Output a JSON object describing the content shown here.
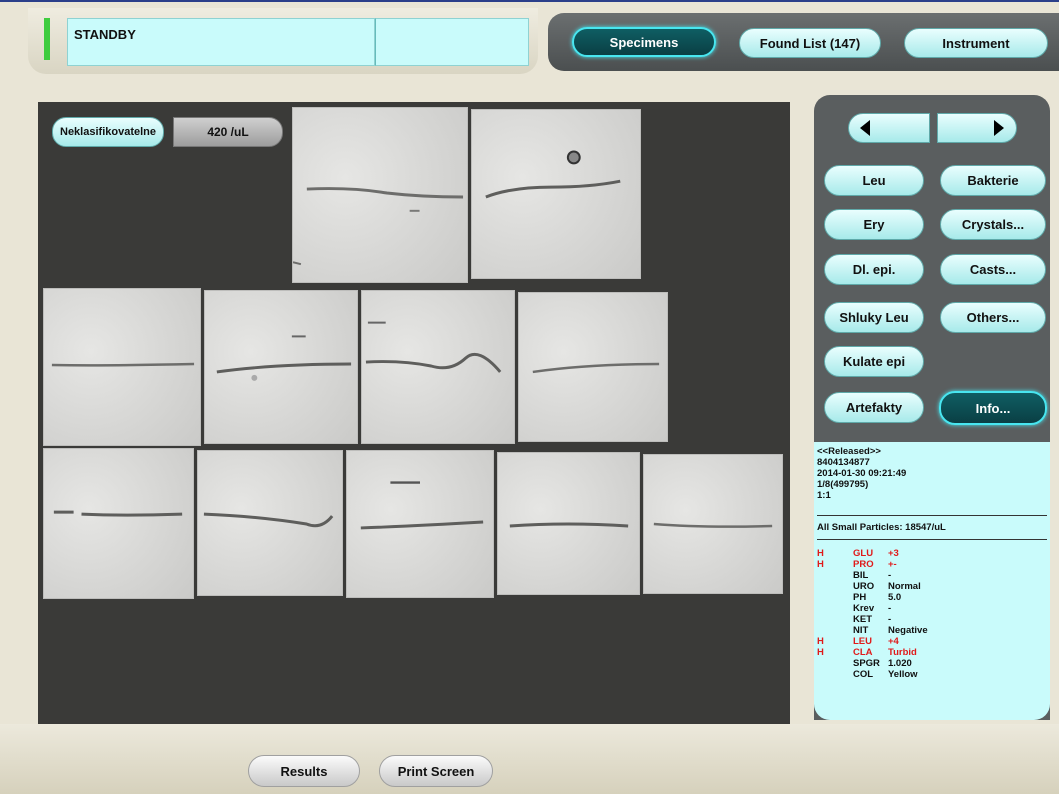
{
  "status": {
    "text": "STANDBY",
    "indicator_color": "#3fcc3f"
  },
  "tabs": [
    {
      "label": "Specimens",
      "active": true
    },
    {
      "label": "Found List (147)",
      "active": false
    },
    {
      "label": "Instrument",
      "active": false
    }
  ],
  "viewer": {
    "class_label": "Neklasifikovatelne",
    "count_label": "420 /uL"
  },
  "categories": [
    {
      "label": "Leu"
    },
    {
      "label": "Bakterie"
    },
    {
      "label": "Ery"
    },
    {
      "label": "Crystals..."
    },
    {
      "label": "Dl. epi."
    },
    {
      "label": "Casts..."
    },
    {
      "label": "Shluky Leu"
    },
    {
      "label": "Others..."
    },
    {
      "label": "Kulate epi"
    },
    {
      "label": "Artefakty"
    },
    {
      "label": "Info...",
      "active": true
    }
  ],
  "info": {
    "released": "<<Released>>",
    "sample_id": "8404134877",
    "datetime": "2014-01-30 09:21:49",
    "rack_pos": "1/8(499795)",
    "dilution": "1:1",
    "small_particles": "All Small Particles: 18547/uL",
    "chemistry": [
      {
        "flag": "H",
        "name": "GLU",
        "value": "+3",
        "high": true
      },
      {
        "flag": "H",
        "name": "PRO",
        "value": "+-",
        "high": true
      },
      {
        "flag": "",
        "name": "BIL",
        "value": "-",
        "high": false
      },
      {
        "flag": "",
        "name": "URO",
        "value": "Normal",
        "high": false
      },
      {
        "flag": "",
        "name": "PH",
        "value": "5.0",
        "high": false
      },
      {
        "flag": "",
        "name": "Krev",
        "value": "-",
        "high": false
      },
      {
        "flag": "",
        "name": "KET",
        "value": "-",
        "high": false
      },
      {
        "flag": "",
        "name": "NIT",
        "value": "Negative",
        "high": false
      },
      {
        "flag": "H",
        "name": "LEU",
        "value": "+4",
        "high": true
      },
      {
        "flag": "H",
        "name": "CLA",
        "value": "Turbid",
        "high": true
      },
      {
        "flag": "",
        "name": "SPGR",
        "value": "1.020",
        "high": false
      },
      {
        "flag": "",
        "name": "COL",
        "value": "Yellow",
        "high": false
      }
    ]
  },
  "bottom": {
    "results_label": "Results",
    "print_label": "Print Screen"
  }
}
